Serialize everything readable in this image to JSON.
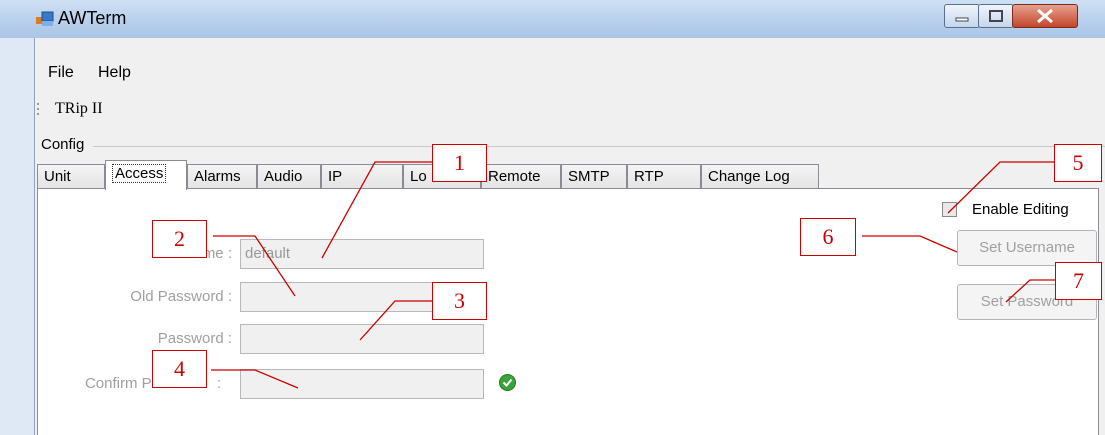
{
  "window": {
    "title": "AWTerm"
  },
  "menu": {
    "file": "File",
    "help": "Help"
  },
  "toolbar": {
    "item": "TRip II"
  },
  "group": {
    "label": "Config"
  },
  "tabs": [
    "Unit",
    "Access",
    "Alarms",
    "Audio",
    "IP",
    "Lo",
    "Remote",
    "SMTP",
    "RTP",
    "Change Log"
  ],
  "active_tab": "Access",
  "form": {
    "name_label": "Name :",
    "name_value": "default",
    "old_password_label": "Old Password :",
    "password_label": "Password :",
    "confirm_label": "Confirm Pa",
    "confirm_label_tail": ":"
  },
  "controls": {
    "enable_editing": "Enable Editing",
    "set_username": "Set Username",
    "set_password": "Set Password"
  },
  "callouts": [
    "1",
    "2",
    "3",
    "4",
    "5",
    "6",
    "7"
  ],
  "colors": {
    "callout": "#cc0000",
    "ok": "#3aa33a"
  }
}
